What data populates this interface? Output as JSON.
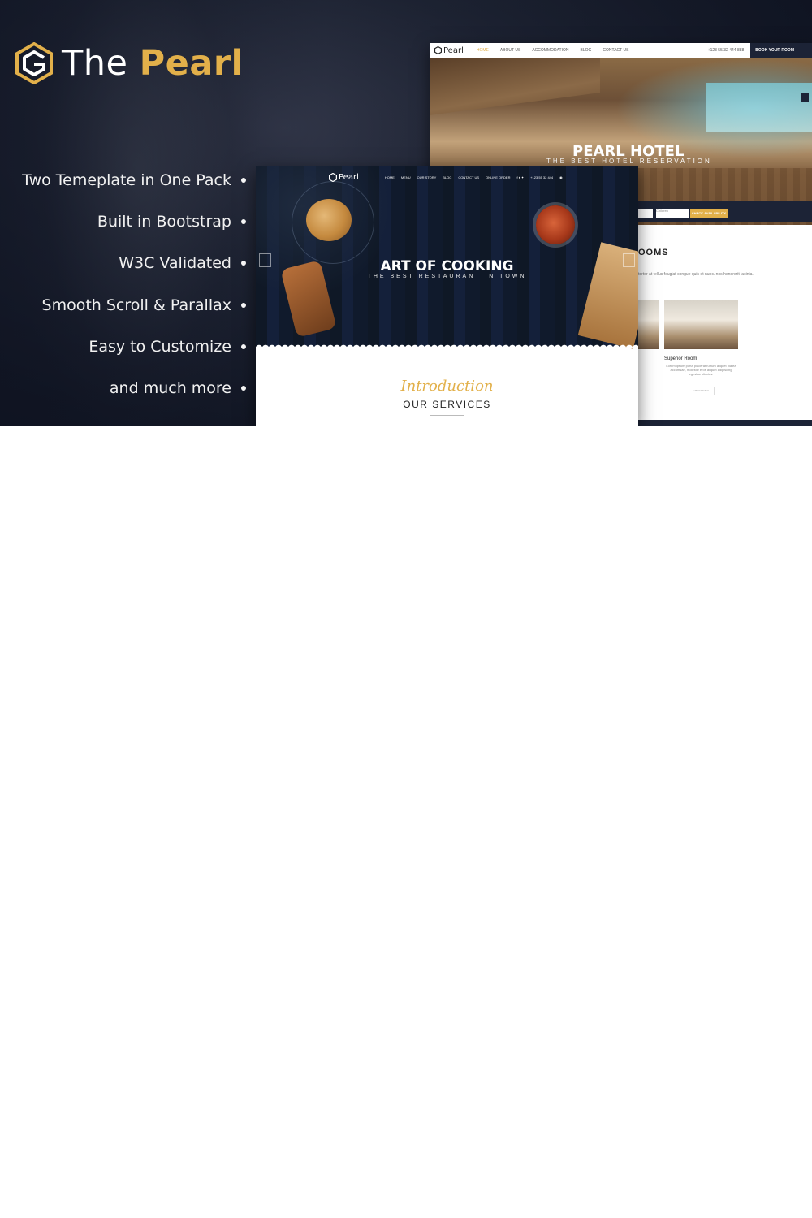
{
  "brand": {
    "name_part1": "The",
    "name_part2": "Pearl",
    "accent_color": "#e2b04a"
  },
  "features": [
    "Two Temeplate in One Pack",
    "Built in Bootstrap",
    "W3C Validated",
    "Smooth Scroll & Parallax",
    "Easy to Customize",
    "and much more"
  ],
  "hotel_preview": {
    "logo": "Pearl",
    "nav": [
      "HOME",
      "ABOUT US",
      "ACCOMMODATION",
      "BLOG",
      "CONTACT US"
    ],
    "phone": "+123 55 32 444 888",
    "book_button": "BOOK YOUR ROOM",
    "hero_title": "PEARL HOTEL",
    "hero_subtitle": "THE BEST HOTEL RESERVATION",
    "field_children": "Children",
    "check_button": "CHECK AVAILABILITY",
    "rooms_heading": "OOMS",
    "rooms_text": "tortor at tellus feugiat congue quis et nunc.\nnos hendrerit lacinia.",
    "room_caption": "Superior Room",
    "room_desc": "Lorem ipsum porta placerat rutrum aliquet platea accumsan, molestie eros aliquet adipiscing egestas ultricies.",
    "view_button": "VIEW DETAIL"
  },
  "restaurant_preview": {
    "logo": "Pearl",
    "nav": [
      "HOME",
      "MENU",
      "OUR STORY",
      "BLOG",
      "CONTACT US",
      "ONLINE ORDER"
    ],
    "phone": "+123 55 32 444",
    "hero_title": "ART OF COOKING",
    "hero_subtitle": "THE BEST RESTAURANT IN TOWN",
    "intro_script": "Introduction",
    "section_heading": "OUR SERVICES"
  }
}
